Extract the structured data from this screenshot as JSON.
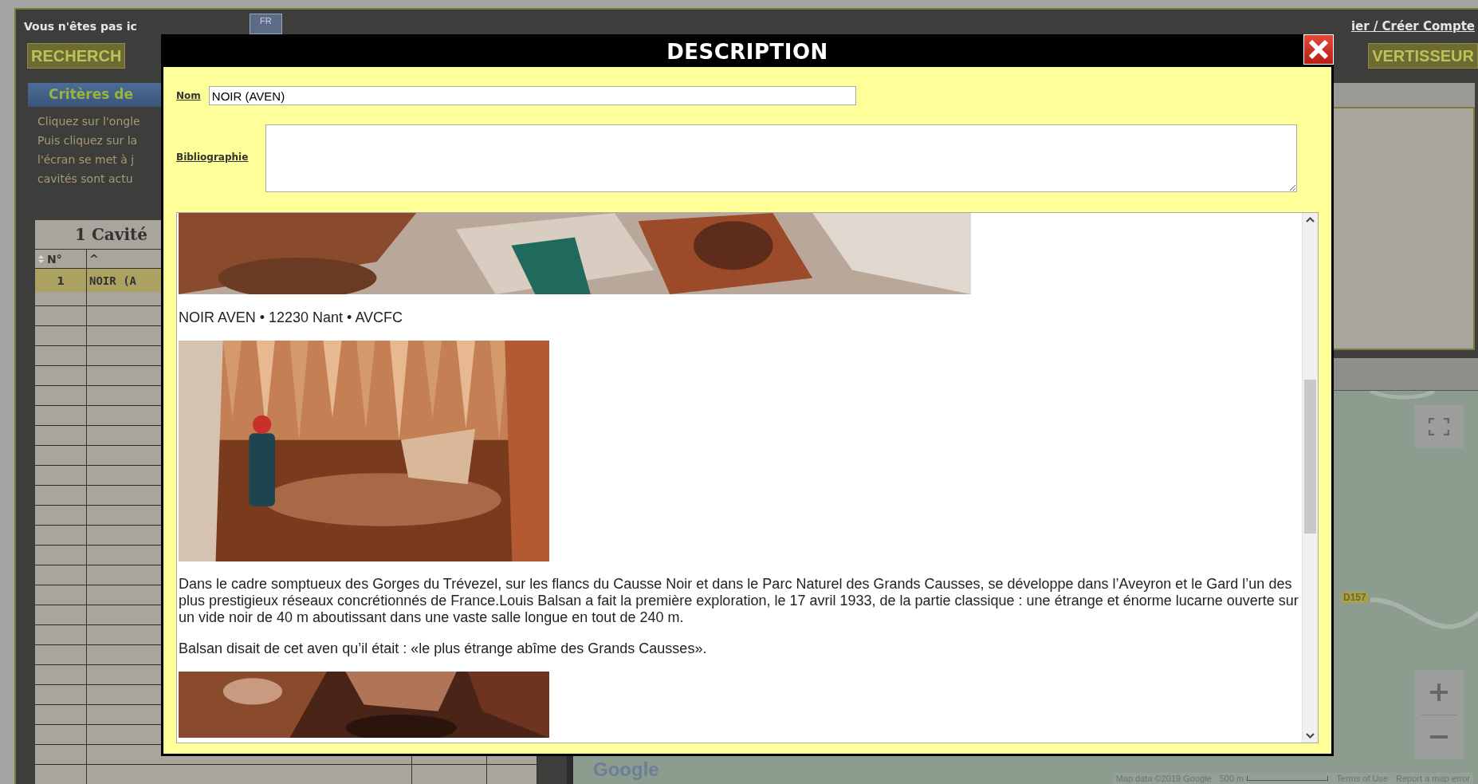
{
  "header": {
    "login_notice": "Vous n'êtes pas ic",
    "language_button": "FR",
    "account_link": "ier / Créer Compte"
  },
  "nav": {
    "left_button": "RECHERCH",
    "right_button": "VERTISSEUR"
  },
  "criteria_panel": {
    "tab": "Critères de",
    "lines": [
      "Cliquez sur l'ongle",
      "Puis cliquez sur la",
      "l'écran se met à j",
      "cavités sont actu"
    ]
  },
  "results_table": {
    "title": "1 Cavité",
    "columns": [
      "N°",
      "^"
    ],
    "rows": [
      {
        "cells": [
          "1",
          "NOIR (A"
        ],
        "selected": true
      }
    ]
  },
  "map": {
    "road_label": "D157",
    "logo": "Google",
    "attribution": [
      "Map data ©2019 Google",
      "500 m",
      "Terms of Use",
      "Report a map error"
    ]
  },
  "dialog": {
    "title": "DESCRIPTION",
    "name_label": "Nom",
    "name_value": "NOIR (AVEN)",
    "bibliography_label": "Bibliographie",
    "content": [
      {
        "kind": "picture"
      },
      {
        "kind": "text",
        "text": "NOIR AVEN • 12230 Nant • AVCFC"
      },
      {
        "kind": "picture"
      },
      {
        "kind": "text",
        "text": "Dans le cadre somptueux des Gorges du Trévezel, sur les flancs du Causse Noir et dans le Parc Naturel des Grands Causses, se développe dans l’Aveyron et le Gard l’un des plus prestigieux réseaux concrétionnés de France.Louis Balsan a fait la première exploration, le 17 avril 1933, de la partie classique : une étrange et énorme lucarne ouverte sur un vide noir de 40 m aboutissant dans une vaste salle longue en tout de 240 m."
      },
      {
        "kind": "text",
        "text": "Balsan disait de cet aven qu’il était : «le plus étrange abîme des Grands Causses»."
      },
      {
        "kind": "picture"
      }
    ]
  }
}
